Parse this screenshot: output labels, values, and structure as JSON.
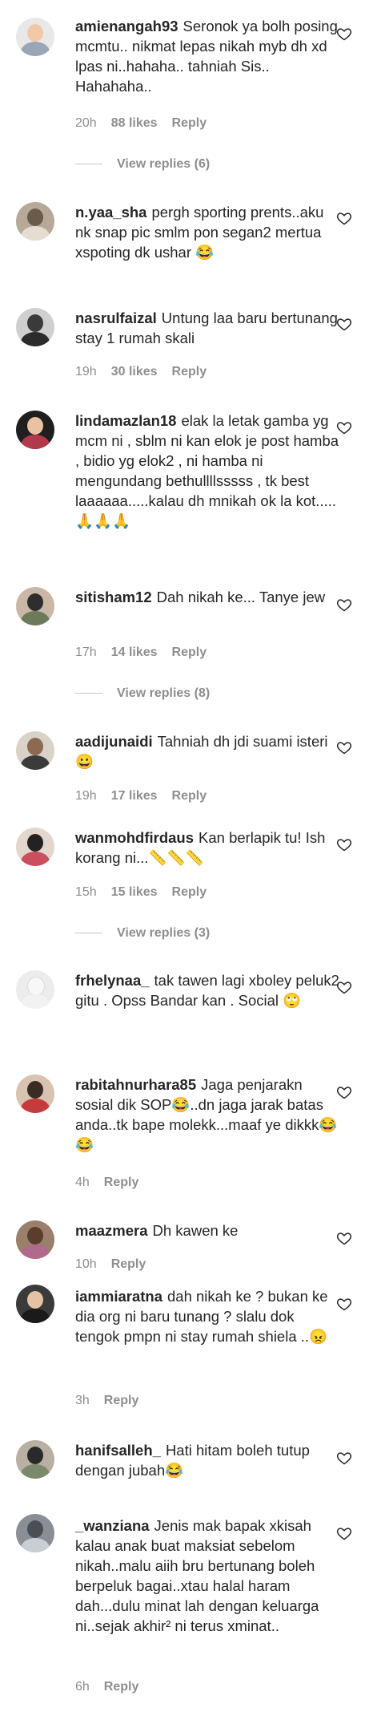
{
  "comments": [
    {
      "username": "amienangah93",
      "text": "Seronok ya bolh posing mcmtu.. nikmat lepas nikah myb dh xd lpas ni..hahaha.. tahniah Sis.. Hahahaha..",
      "time": "20h",
      "likes": "88 likes",
      "reply": "Reply",
      "view_replies": "View replies (6)"
    },
    {
      "username": "n.yaa_sha",
      "text": "pergh sporting prents..aku nk snap pic smlm pon segan2 mertua xspoting dk ushar 😂"
    },
    {
      "username": "nasrulfaizal",
      "text": "Untung laa baru bertunang stay 1 rumah skali",
      "time": "19h",
      "likes": "30 likes",
      "reply": "Reply"
    },
    {
      "username": "lindamazlan18",
      "text": "elak la letak gamba yg mcm ni , sblm ni kan elok je post hamba , bidio yg elok2 , ni hamba ni mengundang bethullllsssss , tk best laaaaaa.....kalau dh mnikah ok la kot.....🙏🙏🙏"
    },
    {
      "username": "sitisham12",
      "text": "Dah nikah ke... Tanye jew",
      "time": "17h",
      "likes": "14 likes",
      "reply": "Reply",
      "view_replies": "View replies (8)"
    },
    {
      "username": "aadijunaidi",
      "text": "Tahniah dh jdi suami isteri 😀",
      "time": "19h",
      "likes": "17 likes",
      "reply": "Reply"
    },
    {
      "username": "wanmohdfirdaus",
      "text": "Kan berlapik tu! Ish korang ni...📏📏📏",
      "time": "15h",
      "likes": "15 likes",
      "reply": "Reply",
      "view_replies": "View replies (3)"
    },
    {
      "username": "frhelynaa_",
      "text": "tak tawen lagi xboley peluk2 gitu . Opss Bandar kan . Social 🙄"
    },
    {
      "username": "rabitahnurhara85",
      "text": "Jaga penjarakn sosial dik SOP😂..dn jaga jarak batas anda..tk bape molekk...maaf ye dikkk😂😂",
      "time": "4h",
      "reply": "Reply"
    },
    {
      "username": "maazmera",
      "text": "Dh kawen ke",
      "time": "10h",
      "reply": "Reply"
    },
    {
      "username": "iammiaratna",
      "text": "dah nikah ke ? bukan ke dia org ni baru tunang ? slalu dok tengok pmpn ni stay rumah shiela ..😠",
      "time": "3h",
      "reply": "Reply"
    },
    {
      "username": "hanifsalleh_",
      "text": "Hati hitam boleh tutup dengan jubah😂"
    },
    {
      "username": "_wanziana",
      "text": "Jenis mak bapak xkisah kalau anak buat maksiat sebelom nikah..malu aiih bru bertunang boleh berpeluk bagai..xtau halal haram dah...dulu minat lah dengan keluarga ni..sejak akhir² ni terus xminat..",
      "time": "6h",
      "reply": "Reply"
    }
  ],
  "colors": {
    "text": "#262626",
    "muted": "#8e8e8e",
    "background": "#ffffff"
  },
  "icons": {
    "like": "heart-outline-icon"
  }
}
